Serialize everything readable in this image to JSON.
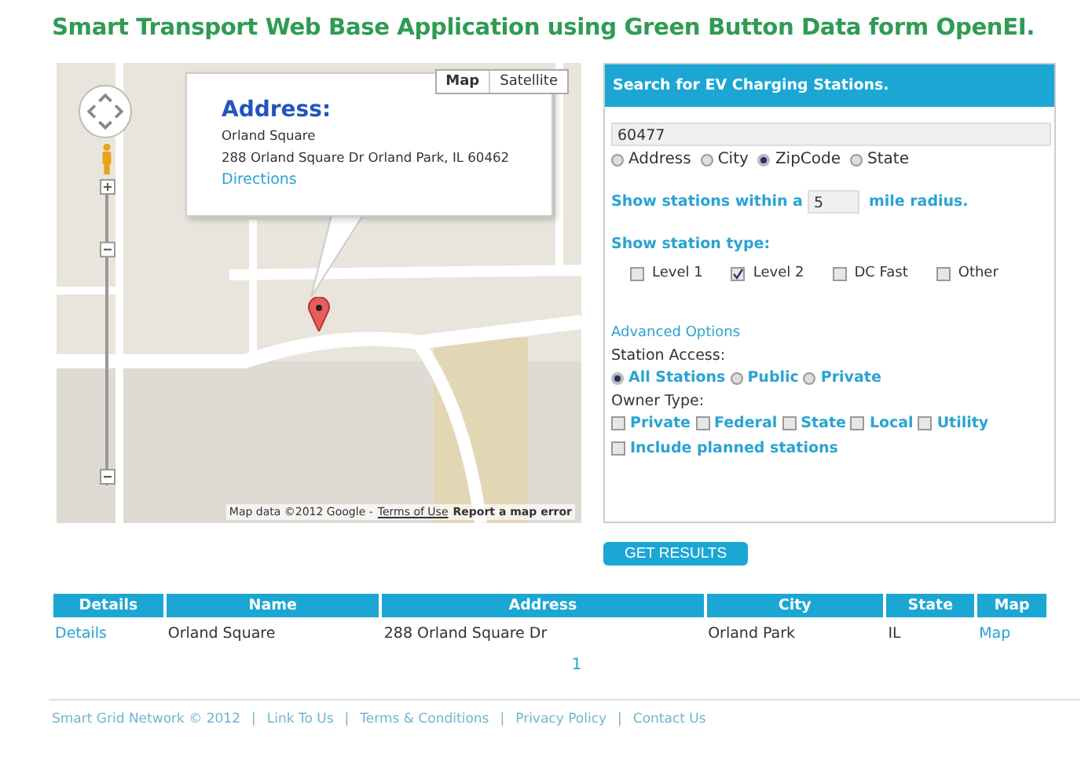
{
  "title": "Smart Transport Web Base Application using Green Button Data form OpenEI.",
  "map": {
    "zoom": {
      "level": 0.77
    },
    "map_types": [
      {
        "label": "Map",
        "selected": true
      },
      {
        "label": "Satellite",
        "selected": false
      }
    ],
    "info_window": {
      "heading": "Address:",
      "name": "Orland Square",
      "address": "288 Orland Square Dr Orland Park, IL 60462",
      "link": "Directions"
    },
    "attribution": {
      "text": "Map data ©2012 Google -",
      "terms": "Terms of Use",
      "report": "Report a map error"
    }
  },
  "search": {
    "header": "Search for EV Charging Stations.",
    "query": "60477",
    "search_by": [
      {
        "label": "Address",
        "selected": false
      },
      {
        "label": "City",
        "selected": false
      },
      {
        "label": "ZipCode",
        "selected": true
      },
      {
        "label": "State",
        "selected": false
      }
    ],
    "radius": {
      "prefix": "Show stations within a",
      "value": "5",
      "suffix": "mile radius."
    },
    "station_type": {
      "label": "Show station type:",
      "options": [
        {
          "label": "Level 1",
          "checked": false
        },
        {
          "label": "Level 2",
          "checked": true
        },
        {
          "label": "DC Fast",
          "checked": false
        },
        {
          "label": "Other",
          "checked": false
        }
      ]
    },
    "advanced": {
      "link": "Advanced Options",
      "access_label": "Station Access:",
      "access": [
        {
          "label": "All Stations",
          "selected": true
        },
        {
          "label": "Public",
          "selected": false
        },
        {
          "label": "Private",
          "selected": false
        }
      ],
      "owner_label": "Owner Type:",
      "owner": [
        {
          "label": "Private",
          "checked": false
        },
        {
          "label": "Federal",
          "checked": false
        },
        {
          "label": "State",
          "checked": false
        },
        {
          "label": "Local",
          "checked": false
        },
        {
          "label": "Utility",
          "checked": false
        }
      ],
      "planned": {
        "label": "Include planned stations",
        "checked": false
      }
    }
  },
  "button": "GET RESULTS",
  "table": {
    "columns": [
      "Details",
      "Name",
      "Address",
      "City",
      "State",
      "Map"
    ],
    "rows": [
      [
        {
          "text": "Details",
          "link": true
        },
        {
          "text": "Orland Square",
          "link": false
        },
        {
          "text": "288 Orland Square Dr",
          "link": false
        },
        {
          "text": "Orland Park",
          "link": false
        },
        {
          "text": "IL",
          "link": false
        },
        {
          "text": "Map",
          "link": true
        }
      ]
    ]
  },
  "pagination": [
    "1"
  ],
  "footer": {
    "separator": "|",
    "items": [
      "Smart Grid Network © 2012",
      "Link To Us",
      "Terms & Conditions",
      "Privacy Policy",
      "Contact Us"
    ]
  }
}
